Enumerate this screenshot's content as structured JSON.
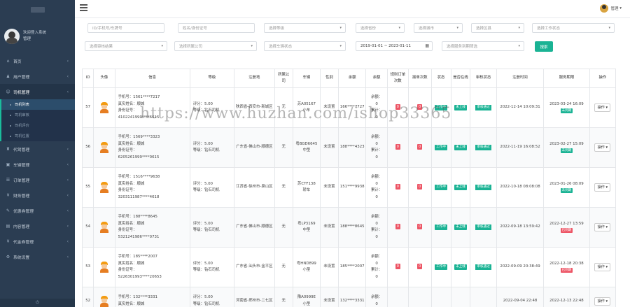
{
  "sidebar": {
    "welcome": "欢迎登入系统",
    "username": "管理",
    "items": [
      {
        "label": "首页",
        "icon": "home-icon",
        "glyph": "⌂"
      },
      {
        "label": "用户管理",
        "icon": "user-icon",
        "glyph": "♟"
      },
      {
        "label": "司机管理",
        "icon": "driver-icon",
        "glyph": "☺"
      }
    ],
    "sub_items": [
      "司机列表",
      "司机审核",
      "司机评价",
      "司机位置"
    ],
    "items2": [
      {
        "label": "代驾管理",
        "icon": "car-icon",
        "glyph": "♜"
      },
      {
        "label": "车辆管理",
        "icon": "truck-icon",
        "glyph": "▣"
      },
      {
        "label": "订单管理",
        "icon": "order-icon",
        "glyph": "☰"
      },
      {
        "label": "财务管理",
        "icon": "money-icon",
        "glyph": "¥"
      },
      {
        "label": "优惠券管理",
        "icon": "coupon-icon",
        "glyph": "✎"
      },
      {
        "label": "内容管理",
        "icon": "content-icon",
        "glyph": "▤"
      },
      {
        "label": "代金券管理",
        "icon": "voucher-icon",
        "glyph": "¥"
      },
      {
        "label": "系统设置",
        "icon": "settings-icon",
        "glyph": "⚙"
      }
    ],
    "bottom": "⏻"
  },
  "topbar": {
    "user": "管理"
  },
  "filters": {
    "phone": "ID/手机号/车牌号",
    "name": "姓名/身份证号",
    "level": "选择等级",
    "province": "选择省份",
    "city": "选择城市",
    "district": "选择区县",
    "work_status": "选择工作状态",
    "review_result": "选择审核结果",
    "company": "选择所属公司",
    "car_status": "选择车辆状态",
    "date_range": "2019-01-01 ~ 2023-01-11",
    "service_expire": "选择服务到期筛选",
    "search": "搜索"
  },
  "table": {
    "headers": [
      "ID",
      "头像",
      "信息",
      "等级",
      "注册地",
      "所属公司",
      "车辆",
      "性别",
      "余额",
      "余额",
      "规则订单次数",
      "接单次数",
      "状态",
      "是否在线",
      "审核状态",
      "注册时间",
      "服务期限",
      "操作"
    ],
    "rows": [
      {
        "id": "57",
        "info": [
          "手机号：1561****7217",
          "真实姓名：顺城",
          "身份证号：",
          "4102241990****6615"
        ],
        "level": [
          "评分：5.00",
          "等级：钻石司机"
        ],
        "region": "陕西省-西安市-新城区",
        "company": "无",
        "car": [
          "苏A05167",
          "小车"
        ],
        "gender": "未设置",
        "balance": "166****7727",
        "money": [
          "余额：",
          "0",
          "累计：",
          "0"
        ],
        "rule": "0",
        "accept": "0",
        "status": "工作中",
        "online": "未上线",
        "review": "审核通过",
        "time": "2022-12-14 10:09:31",
        "expire": "2023-03-24 16:09",
        "badge": "未到期",
        "badge_color": "green",
        "op": "操作"
      },
      {
        "id": "56",
        "info": [
          "手机号：1569****3323",
          "真实姓名：顺城",
          "身份证号：",
          "6205261999****0615"
        ],
        "level": [
          "评分：5.00",
          "等级：钻石司机"
        ],
        "region": "广东省-佛山市-顺德区",
        "company": "无",
        "car": [
          "粤BGD6645",
          "中型"
        ],
        "gender": "未设置",
        "balance": "188****4323",
        "money": [
          "余额：",
          "0",
          "累计：",
          "0"
        ],
        "rule": "0",
        "accept": "0",
        "status": "工作中",
        "online": "未上线",
        "review": "审核通过",
        "time": "2022-11-19 16:08:52",
        "expire": "2023-02-27 15:09",
        "badge": "未到期",
        "badge_color": "green",
        "op": "操作"
      },
      {
        "id": "55",
        "info": [
          "手机号：1516****9638",
          "真实姓名：顺城",
          "身份证号：",
          "3203111987****4618"
        ],
        "level": [
          "评分：5.00",
          "等级：钻石司机"
        ],
        "region": "江苏省-徐州市-泉山区",
        "company": "无",
        "car": [
          "苏CTF138",
          "轿车"
        ],
        "gender": "未设置",
        "balance": "151****9938",
        "money": [
          "余额：",
          "0",
          "累计：",
          "0"
        ],
        "rule": "0",
        "accept": "0",
        "status": "工作中",
        "online": "未上线",
        "review": "审核通过",
        "time": "2022-10-18 08:08:08",
        "expire": "2023-01-26 08:09",
        "badge": "未到期",
        "badge_color": "green",
        "op": "操作"
      },
      {
        "id": "54",
        "info": [
          "手机号：188****8645",
          "真实姓名：顺城",
          "身份证号：",
          "5321241986****0731"
        ],
        "level": [
          "评分：5.00",
          "等级：钻石司机"
        ],
        "region": "广东省-佛山市-顺德区",
        "company": "无",
        "car": [
          "粤LP3169",
          "中型"
        ],
        "gender": "未设置",
        "balance": "188****8645",
        "money": [
          "余额：",
          "0",
          "累计：",
          "0"
        ],
        "rule": "0",
        "accept": "0",
        "status": "工作中",
        "online": "未上线",
        "review": "审核通过",
        "time": "2022-09-18 13:59:42",
        "expire": "2022-12-27 13:59",
        "badge": "已到期",
        "badge_color": "red",
        "op": "操作"
      },
      {
        "id": "53",
        "info": [
          "手机号：185****2007",
          "真实姓名：顺城",
          "身份证号：",
          "5226301993****20653"
        ],
        "level": [
          "评分：5.00",
          "等级：钻石司机"
        ],
        "region": "广东省-汕头市-金平区",
        "company": "无",
        "car": [
          "粤HND899",
          "小型"
        ],
        "gender": "未设置",
        "balance": "185****2007",
        "money": [
          "余额：",
          "0",
          "累计：",
          "0"
        ],
        "rule": "0",
        "accept": "0",
        "status": "工作中",
        "online": "未上线",
        "review": "审核通过",
        "time": "2022-09-09 20:38:49",
        "expire": "2022-12-18 20:38",
        "badge": "已到期",
        "badge_color": "red",
        "op": "操作"
      },
      {
        "id": "52",
        "info": [
          "手机号：132****3331",
          "真实姓名：顺城"
        ],
        "level": [
          "评分：5.00",
          "等级：钻石司机"
        ],
        "region": "河南省-郑州市-二七区",
        "company": "无",
        "car": [
          "豫A0999E",
          "小型"
        ],
        "gender": "未设置",
        "balance": "132****3331",
        "money": [
          "余额：",
          "0"
        ],
        "rule": "",
        "accept": "",
        "status": "",
        "online": "",
        "review": "",
        "time": "2022-09-04 22:48",
        "expire": "2022-12-13 22:48",
        "badge": "",
        "badge_color": "green",
        "op": "操作"
      }
    ]
  },
  "watermark": "https://www.huzhan.com/ishop33365"
}
